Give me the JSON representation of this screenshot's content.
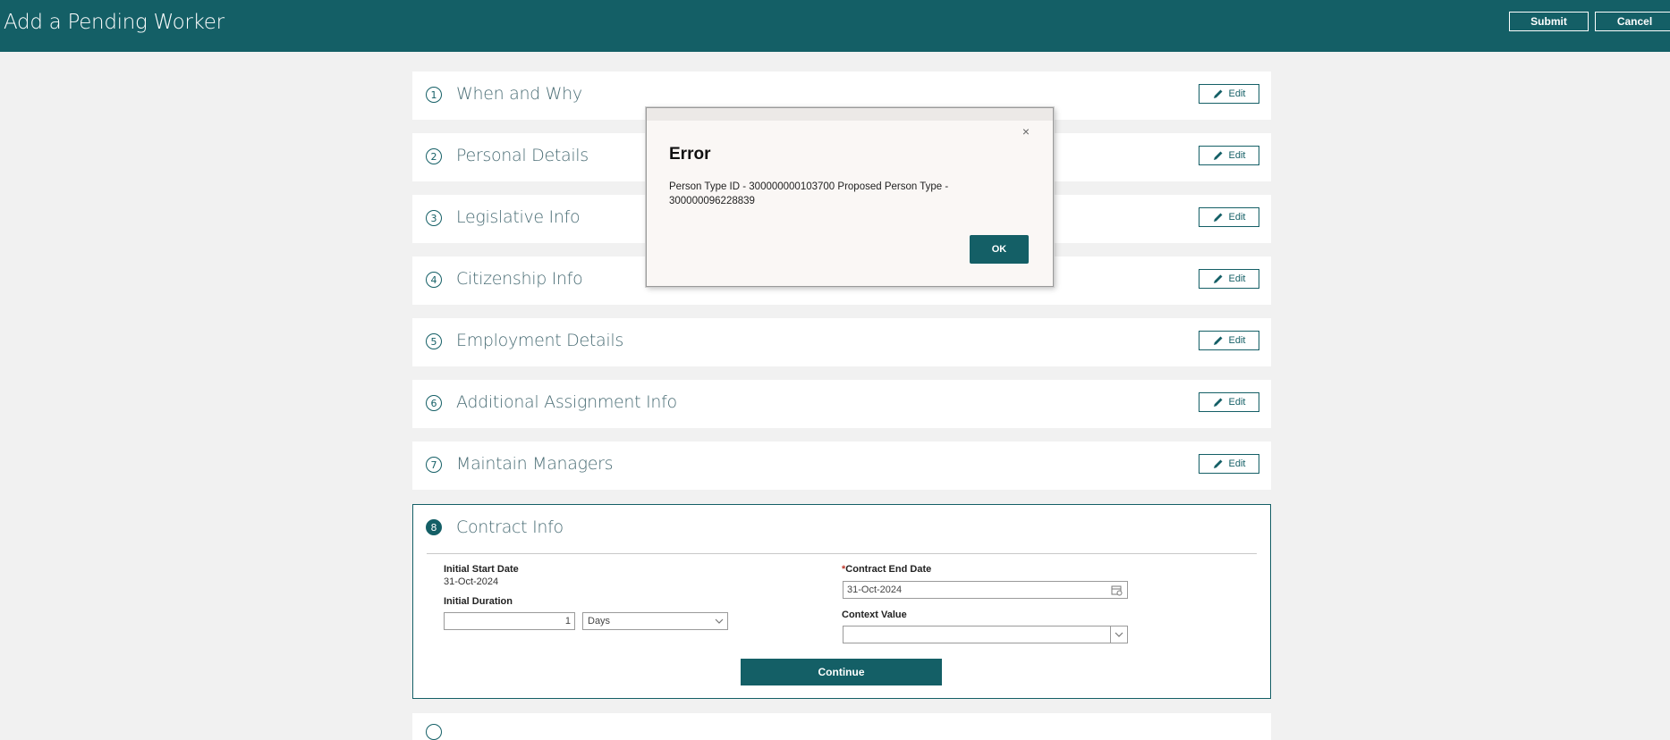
{
  "header": {
    "title": "Add a Pending Worker",
    "submit_label": "Submit",
    "cancel_label": "Cancel"
  },
  "sections": [
    {
      "number": "1",
      "title": "When and Why",
      "edit_label": "Edit"
    },
    {
      "number": "2",
      "title": "Personal Details",
      "edit_label": "Edit"
    },
    {
      "number": "3",
      "title": "Legislative Info",
      "edit_label": "Edit"
    },
    {
      "number": "4",
      "title": "Citizenship Info",
      "edit_label": "Edit"
    },
    {
      "number": "5",
      "title": "Employment Details",
      "edit_label": "Edit"
    },
    {
      "number": "6",
      "title": "Additional Assignment Info",
      "edit_label": "Edit"
    },
    {
      "number": "7",
      "title": "Maintain Managers",
      "edit_label": "Edit"
    }
  ],
  "contract": {
    "number": "8",
    "title": "Contract Info",
    "initial_start_label": "Initial Start Date",
    "initial_start_value": "31-Oct-2024",
    "initial_duration_label": "Initial Duration",
    "duration_value": "1",
    "duration_unit": "Days",
    "required_marker": "*",
    "contract_end_label": "Contract End Date",
    "contract_end_value": "31-Oct-2024",
    "context_value_label": "Context Value",
    "context_value": "",
    "continue_label": "Continue"
  },
  "dialog": {
    "title": "Error",
    "message": "Person Type ID - 300000000103700 Proposed Person Type - 300000096228839",
    "ok_label": "OK",
    "close_symbol": "×"
  },
  "colors": {
    "brand": "#145f66",
    "background": "#f1f1f1"
  }
}
